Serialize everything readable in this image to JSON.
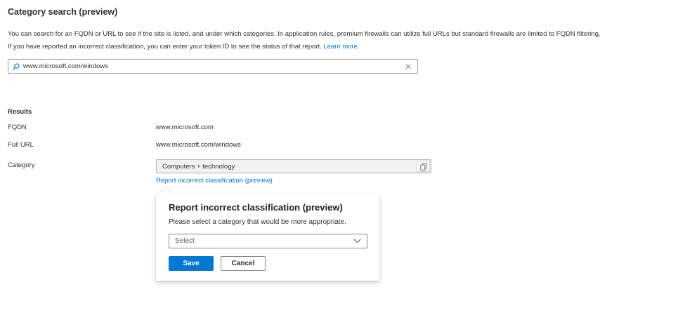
{
  "page": {
    "title": "Category search (preview)",
    "description_line1": "You can search for an FQDN or URL to see if the site is listed, and under which categories. In application rules, premium firewalls can utilize full URLs but standard firewalls are limited to FQDN filtering.",
    "description_line2": "If you have reported an incorrect classification, you can enter your token ID to see the status of that report.",
    "learn_more_label": "Learn more"
  },
  "search": {
    "value": "www.microsoft.com/windows",
    "icons": {
      "left": "search-icon",
      "right": "close-icon"
    }
  },
  "results": {
    "heading": "Results",
    "rows": [
      {
        "label": "FQDN",
        "value": "www.microsoft.com"
      },
      {
        "label": "Full URL",
        "value": "www.microsoft.com/windows"
      },
      {
        "label": "Category",
        "value": "Computers + technology"
      }
    ],
    "copy_icon": "copy-icon",
    "report_link_label": "Report incorrect classification (preview)"
  },
  "callout": {
    "title": "Report incorrect classification (preview)",
    "body": "Please select a category that would be more appropriate.",
    "select_placeholder": "Select",
    "save_label": "Save",
    "cancel_label": "Cancel"
  },
  "colors": {
    "accent": "#0078d4",
    "text": "#323130",
    "muted": "#605e5c",
    "field_background": "#f2f2f1",
    "border": "#8a8886"
  }
}
